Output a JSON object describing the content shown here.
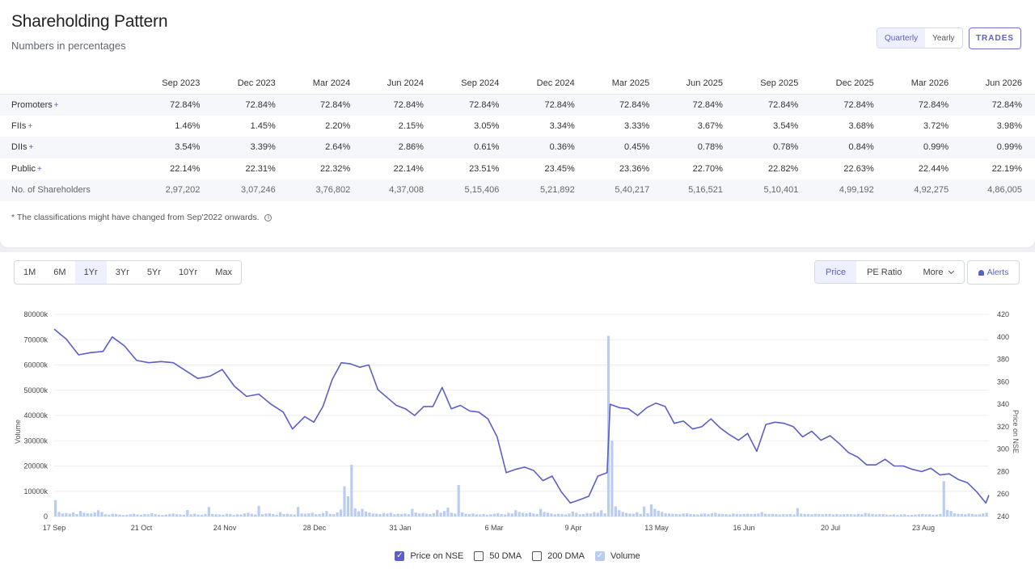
{
  "shareholding": {
    "title": "Shareholding Pattern",
    "subtitle": "Numbers in percentages",
    "period_options": [
      {
        "label": "Quarterly",
        "active": true
      },
      {
        "label": "Yearly",
        "active": false
      }
    ],
    "trades_label": "TRADES",
    "columns": [
      "Sep 2023",
      "Dec 2023",
      "Mar 2024",
      "Jun 2024",
      "Sep 2024",
      "Dec 2024",
      "Mar 2025",
      "Jun 2025",
      "Sep 2025",
      "Dec 2025",
      "Mar 2026",
      "Jun 2026"
    ],
    "rows": [
      {
        "label": "Promoters",
        "expand": "+",
        "values": [
          "72.84%",
          "72.84%",
          "72.84%",
          "72.84%",
          "72.84%",
          "72.84%",
          "72.84%",
          "72.84%",
          "72.84%",
          "72.84%",
          "72.84%",
          "72.84%"
        ]
      },
      {
        "label": "FIIs",
        "expand": "+",
        "values": [
          "1.46%",
          "1.45%",
          "2.20%",
          "2.15%",
          "3.05%",
          "3.34%",
          "3.33%",
          "3.67%",
          "3.54%",
          "3.68%",
          "3.72%",
          "3.98%"
        ]
      },
      {
        "label": "DIIs",
        "expand": "+",
        "values": [
          "3.54%",
          "3.39%",
          "2.64%",
          "2.86%",
          "0.61%",
          "0.36%",
          "0.45%",
          "0.78%",
          "0.78%",
          "0.84%",
          "0.99%",
          "0.99%"
        ]
      },
      {
        "label": "Public",
        "expand": "+",
        "values": [
          "22.14%",
          "22.31%",
          "22.32%",
          "22.14%",
          "23.51%",
          "23.45%",
          "23.36%",
          "22.70%",
          "22.82%",
          "22.63%",
          "22.44%",
          "22.19%"
        ]
      },
      {
        "label": "No. of Shareholders",
        "expand": "",
        "values": [
          "2,97,202",
          "3,07,246",
          "3,76,802",
          "4,37,008",
          "5,15,406",
          "5,21,892",
          "5,40,217",
          "5,16,521",
          "5,10,401",
          "4,99,192",
          "4,92,275",
          "4,86,005"
        ]
      }
    ],
    "footnote": "* The classifications might have changed from Sep'2022 onwards.",
    "footnote_icon": "info-icon"
  },
  "chart_controls": {
    "ranges": [
      {
        "label": "1M",
        "active": false
      },
      {
        "label": "6M",
        "active": false
      },
      {
        "label": "1Yr",
        "active": true
      },
      {
        "label": "3Yr",
        "active": false
      },
      {
        "label": "5Yr",
        "active": false
      },
      {
        "label": "10Yr",
        "active": false
      },
      {
        "label": "Max",
        "active": false
      }
    ],
    "metrics": [
      {
        "label": "Price",
        "active": true
      },
      {
        "label": "PE Ratio",
        "active": false
      },
      {
        "label": "More",
        "active": false,
        "dropdown": true
      }
    ],
    "alerts_label": "Alerts",
    "alerts_icon": "bell-icon"
  },
  "chart_data": {
    "type": "line",
    "x_ticks": [
      "17 Sep",
      "21 Oct",
      "24 Nov",
      "28 Dec",
      "31 Jan",
      "6 Mar",
      "9 Apr",
      "13 May",
      "16 Jun",
      "20 Jul",
      "23 Aug"
    ],
    "left_axis": {
      "label": "Volume",
      "ticks": [
        "0",
        "10000k",
        "20000k",
        "30000k",
        "40000k",
        "50000k",
        "60000k",
        "70000k",
        "80000k"
      ],
      "min": 0,
      "max": 80000
    },
    "right_axis": {
      "label": "Price on NSE",
      "ticks": [
        "240",
        "260",
        "280",
        "300",
        "320",
        "340",
        "360",
        "380",
        "400",
        "420"
      ],
      "min": 240,
      "max": 420
    },
    "grid": true,
    "series": [
      {
        "name": "Price on NSE",
        "kind": "line",
        "axis": "right",
        "color": "#5b5fc7",
        "points": [
          [
            0,
            407
          ],
          [
            4,
            398
          ],
          [
            8,
            384
          ],
          [
            12,
            386
          ],
          [
            16,
            387
          ],
          [
            19,
            400
          ],
          [
            23,
            392
          ],
          [
            27,
            379
          ],
          [
            31,
            377
          ],
          [
            35,
            378
          ],
          [
            39,
            377
          ],
          [
            43,
            370
          ],
          [
            47,
            363
          ],
          [
            51,
            365
          ],
          [
            55,
            371
          ],
          [
            59,
            356
          ],
          [
            63,
            347
          ],
          [
            67,
            349
          ],
          [
            71,
            340
          ],
          [
            75,
            333
          ],
          [
            78,
            318
          ],
          [
            82,
            329
          ],
          [
            85,
            324
          ],
          [
            88,
            338
          ],
          [
            91,
            362
          ],
          [
            94,
            377
          ],
          [
            97,
            376
          ],
          [
            100,
            373
          ],
          [
            103,
            375
          ],
          [
            106,
            353
          ],
          [
            109,
            346
          ],
          [
            112,
            339
          ],
          [
            115,
            336
          ],
          [
            118,
            330
          ],
          [
            121,
            338
          ],
          [
            124,
            338
          ],
          [
            127,
            355
          ],
          [
            130,
            336
          ],
          [
            133,
            339
          ],
          [
            136,
            334
          ],
          [
            139,
            333
          ],
          [
            142,
            327
          ],
          [
            145,
            311
          ],
          [
            148,
            279
          ],
          [
            151,
            282
          ],
          [
            154,
            284
          ],
          [
            157,
            281
          ],
          [
            160,
            272
          ],
          [
            163,
            276
          ],
          [
            166,
            262
          ],
          [
            169,
            252
          ],
          [
            172,
            255
          ],
          [
            175,
            258
          ],
          [
            178,
            276
          ],
          [
            181,
            279
          ],
          [
            182,
            340
          ],
          [
            185,
            337
          ],
          [
            188,
            336
          ],
          [
            191,
            330
          ],
          [
            194,
            337
          ],
          [
            197,
            341
          ],
          [
            200,
            338
          ],
          [
            203,
            323
          ],
          [
            206,
            325
          ],
          [
            209,
            318
          ],
          [
            212,
            320
          ],
          [
            215,
            327
          ],
          [
            218,
            319
          ],
          [
            221,
            313
          ],
          [
            224,
            308
          ],
          [
            227,
            314
          ],
          [
            230,
            298
          ],
          [
            233,
            322
          ],
          [
            236,
            324
          ],
          [
            239,
            323
          ],
          [
            242,
            320
          ],
          [
            245,
            311
          ],
          [
            248,
            316
          ],
          [
            251,
            308
          ],
          [
            254,
            312
          ],
          [
            257,
            305
          ],
          [
            260,
            297
          ],
          [
            263,
            293
          ],
          [
            266,
            286
          ],
          [
            269,
            286
          ],
          [
            272,
            291
          ],
          [
            275,
            285
          ],
          [
            278,
            285
          ],
          [
            281,
            282
          ],
          [
            284,
            280
          ],
          [
            287,
            283
          ],
          [
            290,
            277
          ],
          [
            293,
            278
          ],
          [
            296,
            273
          ],
          [
            299,
            270
          ],
          [
            302,
            262
          ],
          [
            305,
            252
          ],
          [
            306,
            259
          ]
        ],
        "x_scale_note": "x = trading days from 17 Sep"
      },
      {
        "name": "Volume",
        "kind": "bar",
        "axis": "left",
        "color": "#b9cdf2",
        "values": [
          6500,
          1800,
          1200,
          1400,
          1100,
          1600,
          1000,
          2200,
          1500,
          1300,
          1200,
          1600,
          2500,
          1800,
          900,
          700,
          1100,
          1000,
          800,
          600,
          700,
          900,
          1100,
          800,
          700,
          1000,
          900,
          1300,
          1000,
          700,
          600,
          800,
          1000,
          1200,
          900,
          800,
          700,
          2600,
          900,
          1100,
          800,
          700,
          1000,
          3800,
          1000,
          900,
          800,
          700,
          1100,
          1000,
          600,
          900,
          800,
          1200,
          1500,
          1100,
          800,
          4200,
          900,
          1200,
          1300,
          1000,
          700,
          1700,
          1000,
          1100,
          900,
          800,
          3800,
          1200,
          1100,
          1300,
          1500,
          900,
          1000,
          1400,
          2200,
          1000,
          900,
          1600,
          2800,
          12000,
          8000,
          20500,
          3200,
          2100,
          3000,
          2000,
          1600,
          1200,
          1100,
          1000,
          1400,
          1200,
          1500,
          900,
          1100,
          1000,
          1200,
          900,
          3000,
          1600,
          1200,
          1400,
          1100,
          1000,
          1300,
          2600,
          1500,
          2200,
          3500,
          1500,
          1200,
          12500,
          1600,
          1100,
          1000,
          1200,
          900,
          800,
          1000,
          700,
          900,
          1100,
          1300,
          1000,
          800,
          1500,
          1200,
          2500,
          1800,
          1500,
          1300,
          1600,
          1200,
          1000,
          3000,
          1800,
          1500,
          1200,
          900,
          1100,
          1000,
          800,
          1200,
          2000,
          1500,
          900,
          1000,
          1400,
          1200,
          1800,
          1500,
          2500,
          1300,
          71500,
          30000,
          4000,
          2500,
          1800,
          1400,
          1200,
          1100,
          1700,
          1000,
          4000,
          1300,
          4800,
          3000,
          2300,
          1800,
          1300,
          1200,
          1100,
          1000,
          900,
          1200,
          1300,
          1000,
          900,
          800,
          1100,
          1200,
          1000,
          1300,
          1500,
          1100,
          1000,
          900,
          800,
          1200,
          1000,
          900,
          1000,
          1100,
          1000,
          1000,
          1200,
          1800,
          1100,
          1000,
          1000,
          900,
          800,
          1000,
          900,
          1000,
          800,
          3300,
          1200,
          1000,
          1000,
          900,
          1100,
          1000,
          900,
          1000,
          1000,
          800,
          1000,
          800,
          900,
          1000,
          900,
          800,
          1000,
          900,
          1400,
          1200,
          1000,
          800,
          900,
          1000,
          800,
          700,
          900,
          600,
          800,
          900,
          600,
          700,
          800,
          900,
          1000,
          800,
          900,
          700,
          800,
          1000,
          14000,
          2600,
          2200,
          1300,
          1100,
          1000,
          900,
          1200,
          1000,
          800,
          900,
          1200,
          1500
        ]
      }
    ],
    "legend": [
      {
        "label": "Price on NSE",
        "checked": true
      },
      {
        "label": "50 DMA",
        "checked": false
      },
      {
        "label": "200 DMA",
        "checked": false
      },
      {
        "label": "Volume",
        "checked": true
      }
    ]
  }
}
